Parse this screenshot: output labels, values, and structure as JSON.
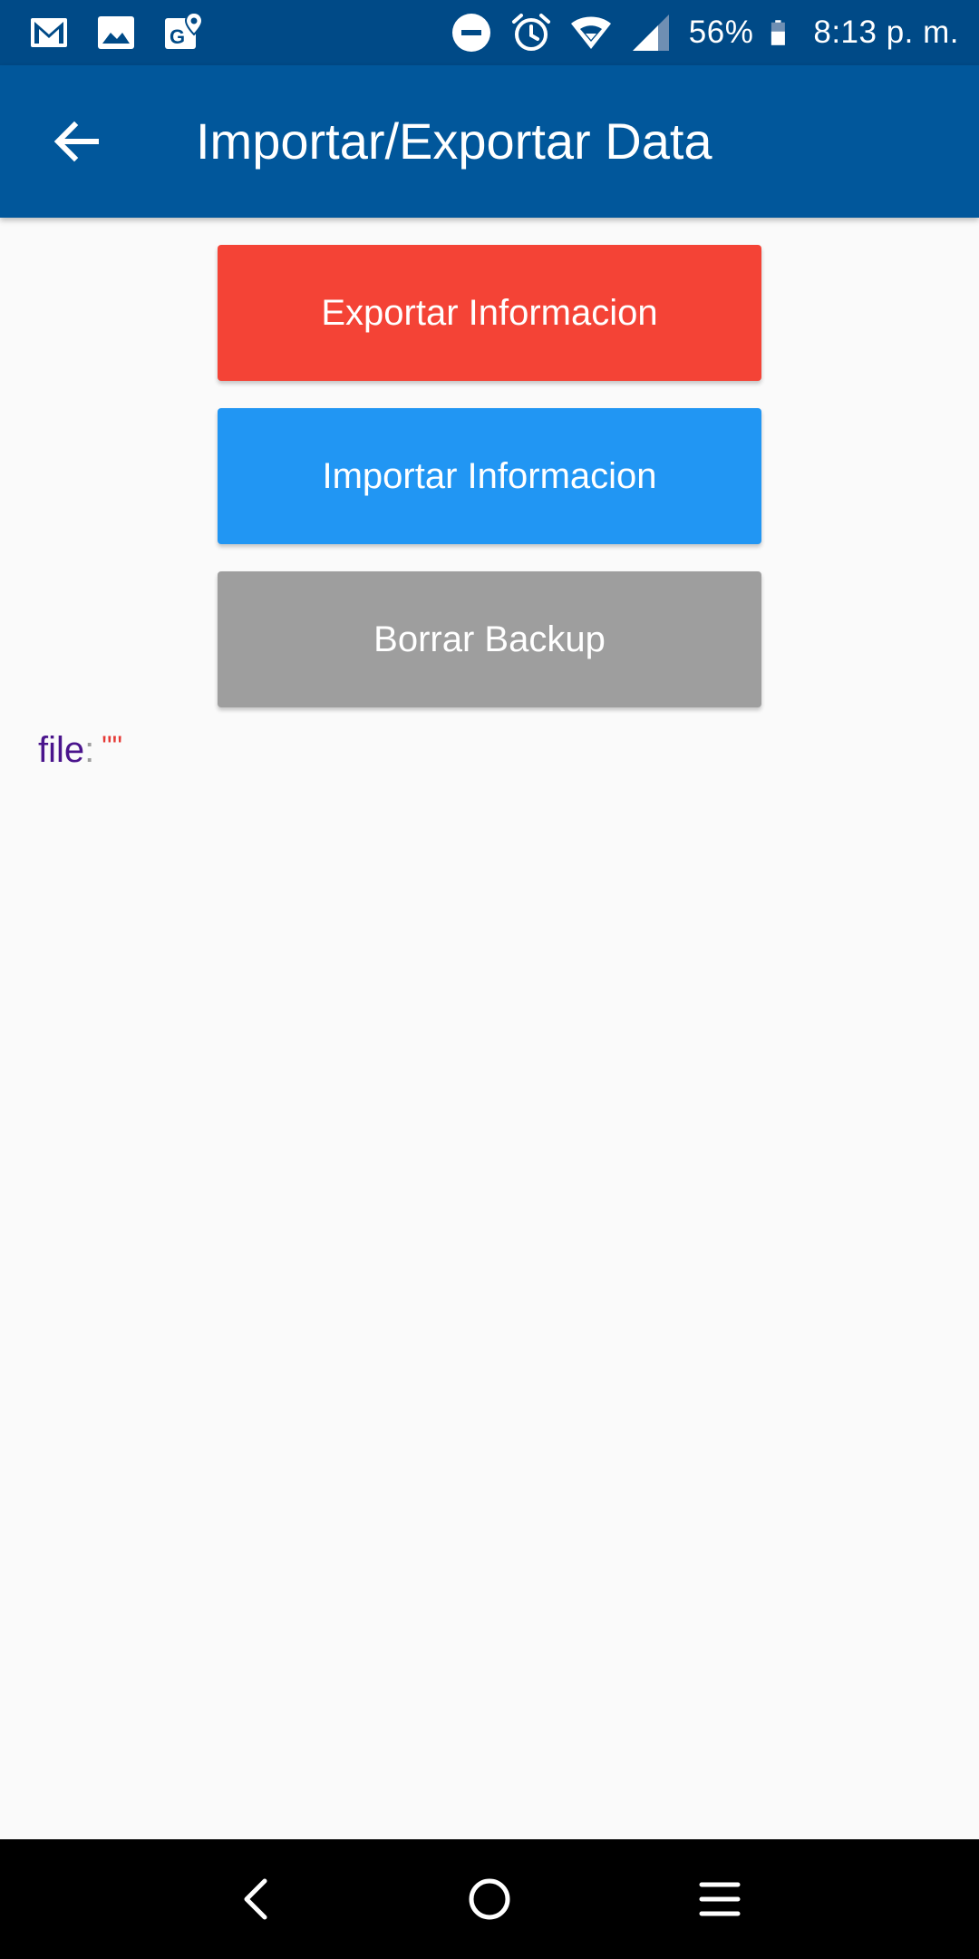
{
  "status_bar": {
    "left_icons": [
      "gmail-icon",
      "gallery-icon",
      "maps-icon"
    ],
    "right_icons": [
      "do-not-disturb-icon",
      "alarm-icon",
      "wifi-icon",
      "cell-signal-icon",
      "battery-icon"
    ],
    "battery_percent": "56%",
    "battery_level": 0.56,
    "time": "8:13 p. m."
  },
  "app_bar": {
    "title": "Importar/Exportar Data",
    "back_icon": "back-arrow-icon"
  },
  "buttons": {
    "export_label": "Exportar Informacion",
    "import_label": "Importar Informacion",
    "delete_label": "Borrar Backup"
  },
  "file_info": {
    "key": "file",
    "separator": ":",
    "value": "\"\""
  },
  "nav_bar": {
    "icons": [
      "back-nav-icon",
      "home-nav-icon",
      "menu-nav-icon"
    ]
  },
  "colors": {
    "status_bar": "#004a87",
    "app_bar": "#01579b",
    "export_button": "#f44336",
    "import_button": "#2196f3",
    "delete_button": "#9e9e9e",
    "background": "#fafafa"
  }
}
